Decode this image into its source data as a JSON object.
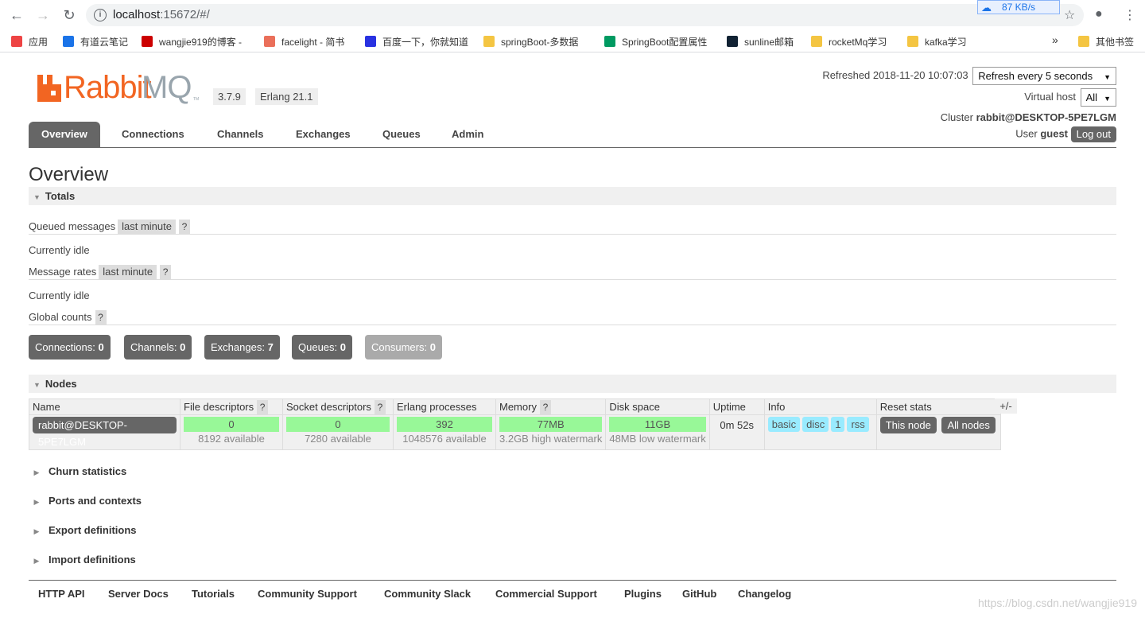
{
  "browser": {
    "url_host": "localhost",
    "url_rest": ":15672/#/",
    "speed": "87 KB/s",
    "bookmarks": [
      {
        "label": "应用",
        "color": "#e44"
      },
      {
        "label": "有道云笔记",
        "color": "#1a73e8"
      },
      {
        "label": "wangjie919的博客 -",
        "color": "#c00"
      },
      {
        "label": "facelight - 简书",
        "color": "#ea6f5a"
      },
      {
        "label": "百度一下，你就知道",
        "color": "#2932e1"
      },
      {
        "label": "springBoot-多数据",
        "color": "#f4c542"
      },
      {
        "label": "SpringBoot配置属性",
        "color": "#009a61"
      },
      {
        "label": "sunline邮箱",
        "color": "#123"
      },
      {
        "label": "rocketMq学习",
        "color": "#f4c542"
      },
      {
        "label": "kafka学习",
        "color": "#f4c542"
      }
    ],
    "more_label": "»",
    "other_bookmarks": "其他书签"
  },
  "header": {
    "logo_rabbit": "Rabbit",
    "logo_mq": "MQ",
    "logo_tm": "TM",
    "version": "3.7.9",
    "erlang": "Erlang 21.1",
    "refreshed_label": "Refreshed 2018-11-20 10:07:03",
    "refresh_select": "Refresh every 5 seconds",
    "vhost_label": "Virtual host",
    "vhost_select": "All",
    "cluster_label": "Cluster",
    "cluster_name": "rabbit@DESKTOP-5PE7LGM",
    "user_label": "User",
    "user_name": "guest",
    "logout": "Log out"
  },
  "tabs": [
    "Overview",
    "Connections",
    "Channels",
    "Exchanges",
    "Queues",
    "Admin"
  ],
  "page_title": "Overview",
  "totals": {
    "header": "Totals",
    "queued_label": "Queued messages",
    "queued_range": "last minute",
    "help": "?",
    "idle1": "Currently idle",
    "rates_label": "Message rates",
    "rates_range": "last minute",
    "idle2": "Currently idle",
    "global_label": "Global counts"
  },
  "counts": [
    {
      "label": "Connections:",
      "value": "0"
    },
    {
      "label": "Channels:",
      "value": "0"
    },
    {
      "label": "Exchanges:",
      "value": "7"
    },
    {
      "label": "Queues:",
      "value": "0"
    },
    {
      "label": "Consumers:",
      "value": "0"
    }
  ],
  "nodes": {
    "header": "Nodes",
    "columns": [
      "Name",
      "File descriptors",
      "Socket descriptors",
      "Erlang processes",
      "Memory",
      "Disk space",
      "Uptime",
      "Info",
      "Reset stats"
    ],
    "plusminus": "+/-",
    "row": {
      "name": "rabbit@DESKTOP-5PE7LGM",
      "fd_value": "0",
      "fd_sub": "8192 available",
      "sd_value": "0",
      "sd_sub": "7280 available",
      "ep_value": "392",
      "ep_sub": "1048576 available",
      "mem_value": "77MB",
      "mem_sub": "3.2GB high watermark",
      "disk_value": "11GB",
      "disk_sub": "48MB low watermark",
      "uptime": "0m 52s",
      "info_tags": [
        "basic",
        "disc",
        "1",
        "rss"
      ],
      "reset_this": "This node",
      "reset_all": "All nodes"
    }
  },
  "collapsed_sections": [
    "Churn statistics",
    "Ports and contexts",
    "Export definitions",
    "Import definitions"
  ],
  "footer": [
    "HTTP API",
    "Server Docs",
    "Tutorials",
    "Community Support",
    "Community Slack",
    "Commercial Support",
    "Plugins",
    "GitHub",
    "Changelog"
  ],
  "watermark": "https://blog.csdn.net/wangjie919"
}
